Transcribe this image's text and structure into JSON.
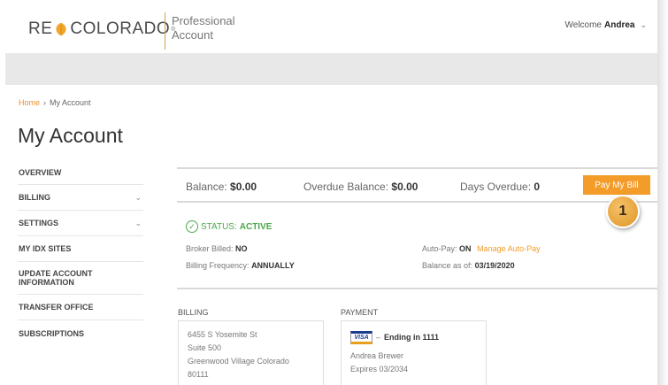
{
  "header": {
    "logo_left": "RE",
    "logo_right": "COLORADO",
    "logo_reg": "®",
    "sub_line1": "Professional",
    "sub_line2": "Account",
    "welcome_prefix": "Welcome",
    "welcome_user": "Andrea",
    "welcome_chevron": "⌄"
  },
  "breadcrumb": {
    "home": "Home",
    "separator": "›",
    "current": "My Account"
  },
  "page_title": "My Account",
  "sidebar": {
    "items": [
      {
        "label": "OVERVIEW",
        "chevron": ""
      },
      {
        "label": "BILLING",
        "chevron": "⌄"
      },
      {
        "label": "SETTINGS",
        "chevron": "⌄"
      },
      {
        "label": "MY IDX SITES",
        "chevron": ""
      },
      {
        "label": "UPDATE ACCOUNT INFORMATION",
        "chevron": ""
      },
      {
        "label": "TRANSFER OFFICE",
        "chevron": ""
      },
      {
        "label": "SUBSCRIPTIONS",
        "chevron": ""
      }
    ]
  },
  "balance": {
    "balance_label": "Balance:",
    "balance_value": "$0.00",
    "overdue_label": "Overdue Balance:",
    "overdue_value": "$0.00",
    "days_label": "Days Overdue:",
    "days_value": "0",
    "pay_button": "Pay My Bill"
  },
  "badge": "1",
  "status": {
    "label": "STATUS:",
    "value": "ACTIVE",
    "broker_label": "Broker Billed:",
    "broker_value": "NO",
    "freq_label": "Billing Frequency:",
    "freq_value": "ANNUALLY",
    "autopay_label": "Auto-Pay:",
    "autopay_value": "ON",
    "autopay_link": "Manage Auto-Pay",
    "asof_label": "Balance as of:",
    "asof_value": "03/19/2020"
  },
  "billing": {
    "heading": "BILLING",
    "line1": "6455 S Yosemite St",
    "line2": "Suite 500",
    "line3": "Greenwood Village Colorado",
    "line4": "80111"
  },
  "payment": {
    "heading": "PAYMENT",
    "card_brand": "VISA",
    "dash": "–",
    "ending": "Ending in 1111",
    "name": "Andrea Brewer",
    "expires": "Expires 03/2034"
  },
  "colors": {
    "accent": "#f39c2a",
    "status_active": "#4aa84a",
    "band": "#e8e8e8"
  }
}
